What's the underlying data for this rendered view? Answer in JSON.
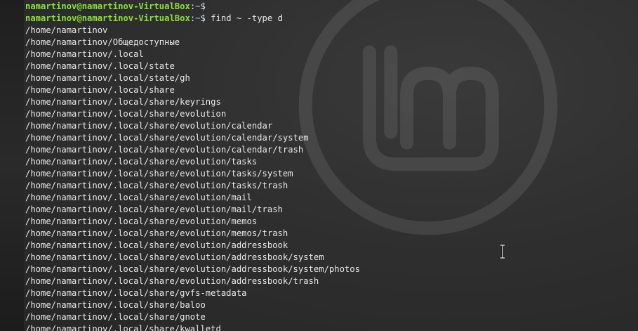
{
  "terminal": {
    "prompts": [
      {
        "user_host": "namartinov@namartinov-VirtualBox",
        "sep": ":",
        "path": "~",
        "symbol": "$",
        "command": ""
      },
      {
        "user_host": "namartinov@namartinov-VirtualBox",
        "sep": ":",
        "path": "~",
        "symbol": "$",
        "command": " find ~ -type d"
      }
    ],
    "output": [
      "/home/namartinov",
      "/home/namartinov/Общедоступные",
      "/home/namartinov/.local",
      "/home/namartinov/.local/state",
      "/home/namartinov/.local/state/gh",
      "/home/namartinov/.local/share",
      "/home/namartinov/.local/share/keyrings",
      "/home/namartinov/.local/share/evolution",
      "/home/namartinov/.local/share/evolution/calendar",
      "/home/namartinov/.local/share/evolution/calendar/system",
      "/home/namartinov/.local/share/evolution/calendar/trash",
      "/home/namartinov/.local/share/evolution/tasks",
      "/home/namartinov/.local/share/evolution/tasks/system",
      "/home/namartinov/.local/share/evolution/tasks/trash",
      "/home/namartinov/.local/share/evolution/mail",
      "/home/namartinov/.local/share/evolution/mail/trash",
      "/home/namartinov/.local/share/evolution/memos",
      "/home/namartinov/.local/share/evolution/memos/trash",
      "/home/namartinov/.local/share/evolution/addressbook",
      "/home/namartinov/.local/share/evolution/addressbook/system",
      "/home/namartinov/.local/share/evolution/addressbook/system/photos",
      "/home/namartinov/.local/share/evolution/addressbook/trash",
      "/home/namartinov/.local/share/gvfs-metadata",
      "/home/namartinov/.local/share/baloo",
      "/home/namartinov/.local/share/gnote",
      "/home/namartinov/.local/share/kwalletd"
    ]
  },
  "colors": {
    "prompt_user": "#8ae234",
    "prompt_path": "#729fcf",
    "text": "#e8e8e8",
    "background": "#2b2b2b"
  },
  "icons": {
    "wallpaper": "linux-mint-logo-icon",
    "pointer": "text-cursor-icon"
  }
}
